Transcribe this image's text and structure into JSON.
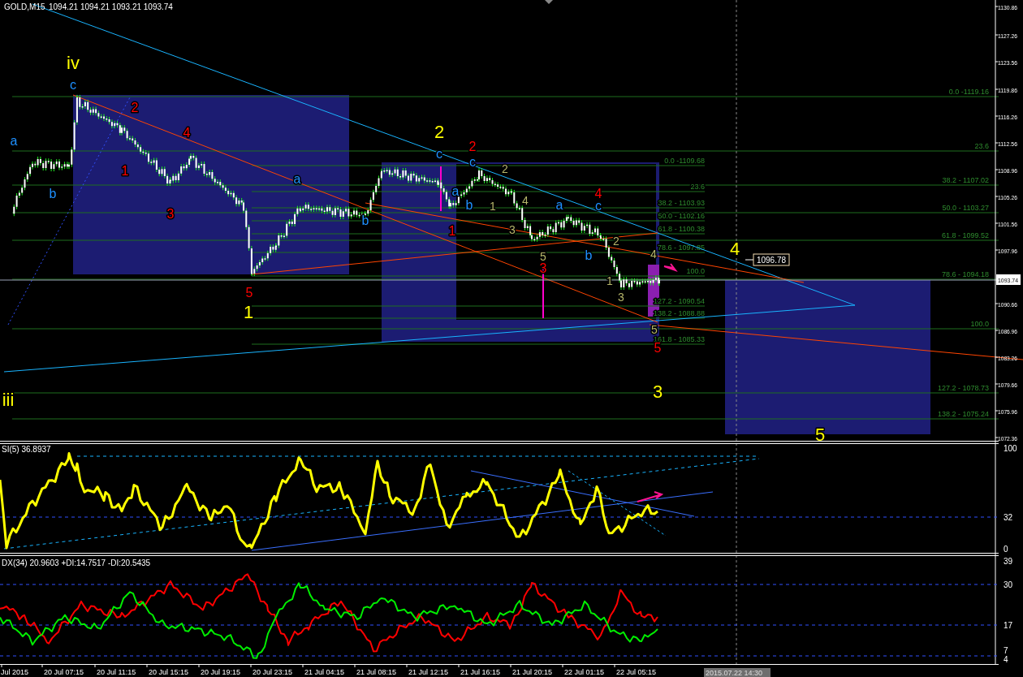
{
  "header": {
    "symbol": "GOLD,M15",
    "ohlc": [
      "1094.21",
      "1094.21",
      "1093.21",
      "1093.74"
    ]
  },
  "price_axis": {
    "labels": [
      "1130.86",
      "1127.26",
      "1123.56",
      "1119.86",
      "1116.26",
      "1112.56",
      "1108.96",
      "1105.26",
      "1101.56",
      "1097.96",
      "1090.66",
      "1086.96",
      "1083.26",
      "1079.66",
      "1075.96",
      "1072.36"
    ],
    "current_price": "1093.74"
  },
  "fib_levels_outer": [
    "0.0 -1119.16",
    "23.6",
    "38.2 - 1107.02",
    "50.0 - 1103.27",
    "61.8 - 1099.52",
    "78.6 - 1094.18",
    "100.0",
    "127.2 - 1078.73",
    "138.2 - 1075.24"
  ],
  "fib_levels_inner": [
    "0.0 -1109.68",
    "23.6",
    "38.2 - 1103.93",
    "50.0 - 1102.16",
    "61.8 - 1100.38",
    "78.6 - 1097.85",
    "100.0",
    "127.2 - 1090.54",
    "138.2 - 1088.88",
    "161.8 - 1085.33"
  ],
  "price_tag": "1096.78",
  "wave_labels": [
    {
      "text": "iv",
      "kind": "primary",
      "color": "#ffff00"
    },
    {
      "text": "2",
      "kind": "primary",
      "color": "#ffff00"
    },
    {
      "text": "4",
      "kind": "primary",
      "color": "#ffff00"
    },
    {
      "text": "1",
      "kind": "primary",
      "color": "#ffff00"
    },
    {
      "text": "3",
      "kind": "primary",
      "color": "#ffff00"
    },
    {
      "text": "iii",
      "kind": "primary",
      "color": "#ffff00"
    },
    {
      "text": "5",
      "kind": "primary",
      "color": "#ffff00"
    },
    {
      "text": "c",
      "kind": "intermediate",
      "color": "#1e90ff"
    },
    {
      "text": "a",
      "kind": "intermediate",
      "color": "#1e90ff"
    },
    {
      "text": "b",
      "kind": "intermediate",
      "color": "#1e90ff"
    },
    {
      "text": "a",
      "kind": "intermediate",
      "color": "#1e90ff"
    },
    {
      "text": "b",
      "kind": "intermediate",
      "color": "#1e90ff"
    },
    {
      "text": "c",
      "kind": "intermediate",
      "color": "#1e90ff"
    },
    {
      "text": "a",
      "kind": "intermediate",
      "color": "#1e90ff"
    },
    {
      "text": "b",
      "kind": "intermediate",
      "color": "#1e90ff"
    },
    {
      "text": "c",
      "kind": "intermediate",
      "color": "#1e90ff"
    },
    {
      "text": "a",
      "kind": "intermediate",
      "color": "#1e90ff"
    },
    {
      "text": "c",
      "kind": "intermediate",
      "color": "#1e90ff"
    },
    {
      "text": "b",
      "kind": "intermediate",
      "color": "#1e90ff"
    },
    {
      "text": "2",
      "kind": "intermediate",
      "color": "#ff0000"
    },
    {
      "text": "4",
      "kind": "intermediate",
      "color": "#ff0000"
    },
    {
      "text": "1",
      "kind": "intermediate",
      "color": "#ff0000"
    },
    {
      "text": "3",
      "kind": "intermediate",
      "color": "#ff0000"
    },
    {
      "text": "5",
      "kind": "intermediate",
      "color": "#ff0000"
    },
    {
      "text": "1",
      "kind": "intermediate",
      "color": "#ff0000"
    },
    {
      "text": "2",
      "kind": "intermediate",
      "color": "#ff0000"
    },
    {
      "text": "4",
      "kind": "intermediate",
      "color": "#ff0000"
    },
    {
      "text": "3",
      "kind": "intermediate",
      "color": "#ff0000"
    },
    {
      "text": "5",
      "kind": "intermediate",
      "color": "#ff0000"
    },
    {
      "text": "2",
      "kind": "minor",
      "color": "#b5b56a"
    },
    {
      "text": "1",
      "kind": "minor",
      "color": "#b5b56a"
    },
    {
      "text": "4",
      "kind": "minor",
      "color": "#b5b56a"
    },
    {
      "text": "3",
      "kind": "minor",
      "color": "#b5b56a"
    },
    {
      "text": "5",
      "kind": "minor",
      "color": "#b5b56a"
    },
    {
      "text": "2",
      "kind": "minor",
      "color": "#b5b56a"
    },
    {
      "text": "4",
      "kind": "minor",
      "color": "#b5b56a"
    },
    {
      "text": "1",
      "kind": "minor",
      "color": "#b5b56a"
    },
    {
      "text": "3",
      "kind": "minor",
      "color": "#b5b56a"
    },
    {
      "text": "5",
      "kind": "minor",
      "color": "#b5b56a"
    }
  ],
  "rsi_panel": {
    "title": "SI(5) 36.8937",
    "axis": [
      "100",
      "32",
      "0"
    ]
  },
  "adx_panel": {
    "title": "DX(34) 20.9603 +DI:14.7517 -DI:20.5435",
    "axis": [
      "39",
      "30",
      "17",
      "7",
      "4"
    ]
  },
  "time_axis": {
    "labels": [
      "Jul 2015",
      "20 Jul 07:15",
      "20 Jul 11:15",
      "20 Jul 15:15",
      "20 Jul 19:15",
      "20 Jul 23:15",
      "21 Jul 04:15",
      "21 Jul 08:15",
      "21 Jul 12:15",
      "21 Jul 16:15",
      "21 Jul 20:15",
      "22 Jul 01:15",
      "22 Jul 05:15"
    ],
    "cursor_label": "2015.07.22 14:30"
  }
}
